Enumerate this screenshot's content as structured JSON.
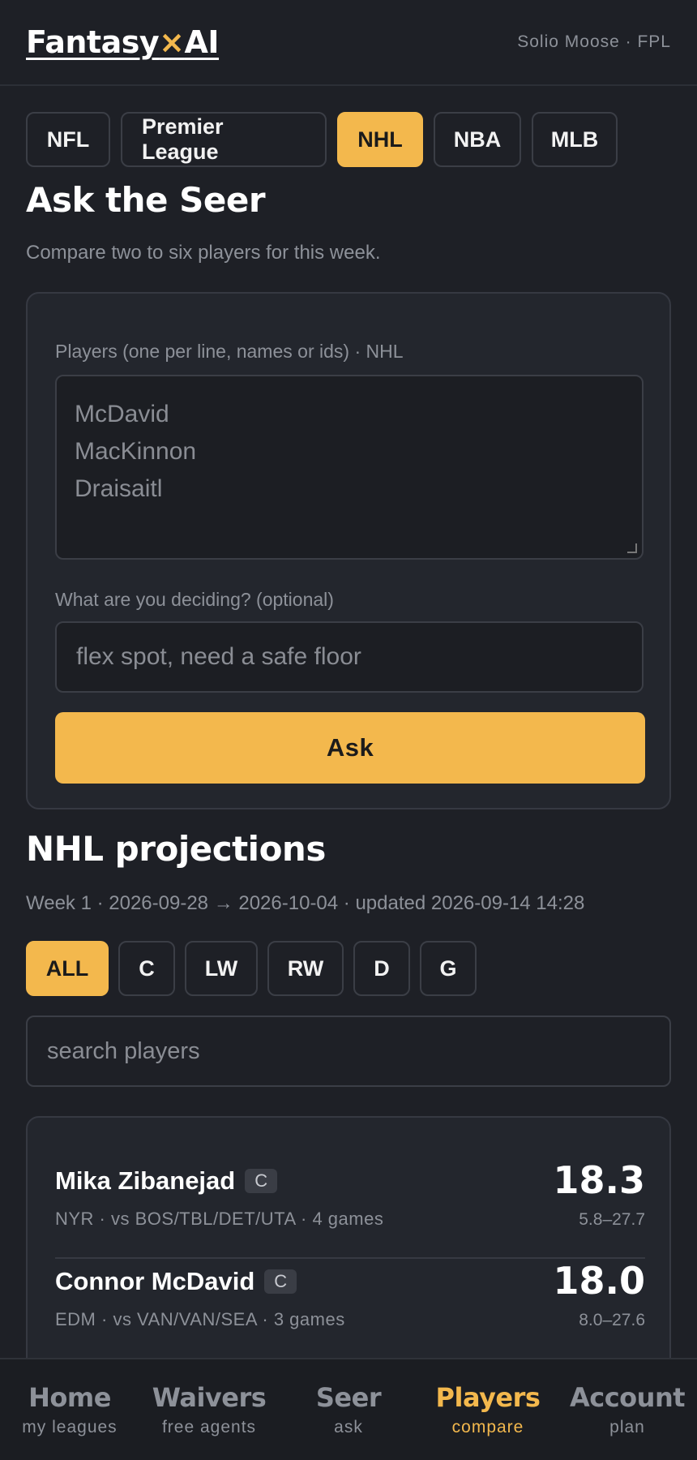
{
  "header": {
    "logo_part1": "Fantasy",
    "logo_x": "×",
    "logo_part2": "AI",
    "user": "Solio Moose · FPL"
  },
  "sport_tabs": [
    "NFL",
    "Premier League",
    "NHL",
    "NBA",
    "MLB"
  ],
  "active_sport": "NHL",
  "seer": {
    "title": "Ask the Seer",
    "subtitle": "Compare two to six players for this week.",
    "players_label": "Players (one per line, names or ids) · NHL",
    "players_placeholder_lines": [
      "McDavid",
      "MacKinnon",
      "Draisaitl"
    ],
    "deciding_label": "What are you deciding? (optional)",
    "deciding_placeholder": "flex spot, need a safe floor",
    "ask_button": "Ask"
  },
  "projections": {
    "title": "NHL projections",
    "subtitle": "Week 1 · 2026-09-28 → 2026-10-04 · updated 2026-09-14 14:28",
    "position_tabs": [
      "ALL",
      "C",
      "LW",
      "RW",
      "D",
      "G"
    ],
    "active_position": "ALL",
    "search_placeholder": "search players",
    "players": [
      {
        "name": "Mika Zibanejad",
        "pos": "C",
        "meta": "NYR · vs BOS/TBL/DET/UTA · 4 games",
        "score": "18.3",
        "range": "5.8–27.7"
      },
      {
        "name": "Connor McDavid",
        "pos": "C",
        "meta": "EDM · vs VAN/VAN/SEA · 3 games",
        "score": "18.0",
        "range": "8.0–27.6"
      }
    ]
  },
  "bottom_nav": [
    {
      "title": "Home",
      "sub": "my leagues"
    },
    {
      "title": "Waivers",
      "sub": "free agents"
    },
    {
      "title": "Seer",
      "sub": "ask"
    },
    {
      "title": "Players",
      "sub": "compare"
    },
    {
      "title": "Account",
      "sub": "plan"
    }
  ],
  "active_nav": "Players",
  "colors": {
    "accent": "#f3b84d",
    "background": "#1e2026",
    "card": "#23262d"
  }
}
